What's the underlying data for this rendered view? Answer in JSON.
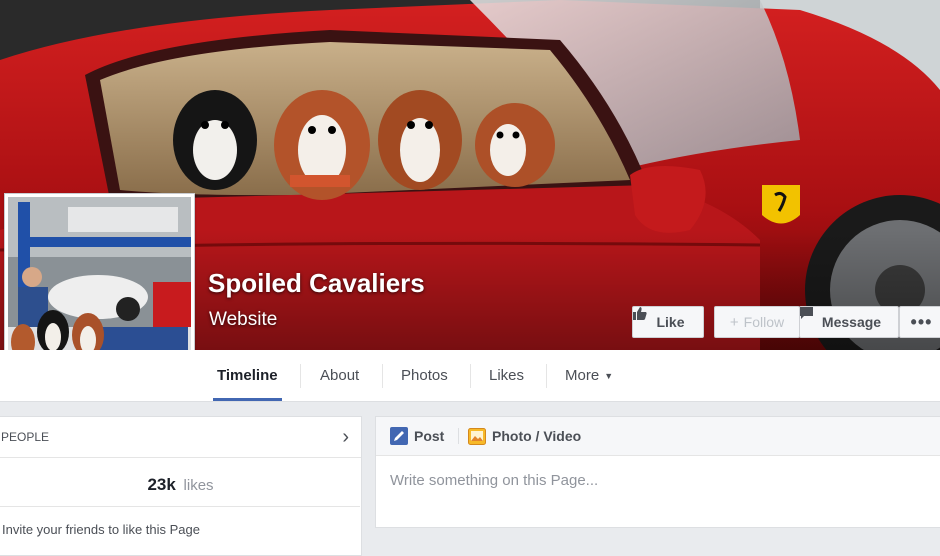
{
  "page": {
    "name": "Spoiled Cavaliers",
    "category": "Website"
  },
  "actions": {
    "like_label": "Like",
    "follow_label": "Follow",
    "message_label": "Message",
    "more_label": "•••"
  },
  "nav": {
    "tabs": [
      {
        "label": "Timeline",
        "active": true
      },
      {
        "label": "About"
      },
      {
        "label": "Photos"
      },
      {
        "label": "Likes"
      },
      {
        "label": "More"
      }
    ]
  },
  "people": {
    "header": "PEOPLE",
    "likes_count": "23k",
    "likes_label": "likes",
    "invite_text": "Invite your friends to like this Page"
  },
  "composer": {
    "post_label": "Post",
    "photo_video_label": "Photo / Video",
    "placeholder": "Write something on this Page..."
  },
  "colors": {
    "accent": "#4267b2",
    "cover_red": "#b51515"
  },
  "icons": {
    "like": "thumbs-up-icon",
    "follow": "plus-icon",
    "message": "message-icon",
    "more": "ellipsis-icon",
    "post": "pencil-icon",
    "photo": "photo-icon",
    "people_arrow": "chevron-right-icon"
  }
}
